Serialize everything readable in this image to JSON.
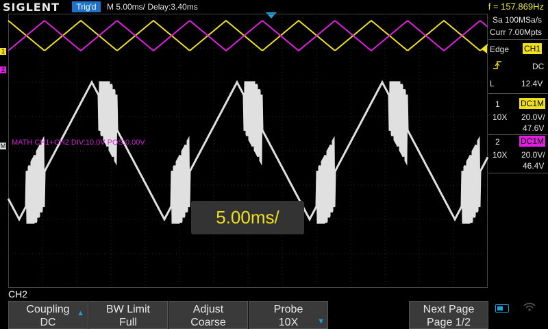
{
  "header": {
    "brand": "SIGLENT",
    "trigger_status": "Trig'd",
    "timebase": "M 5.00ms/ Delay:3.40ms",
    "frequency": "f = 157.869Hz"
  },
  "acquisition": {
    "sample_rate": "Sa 100MSa/s",
    "memory": "Curr 7.00Mpts"
  },
  "trigger": {
    "type": "Edge",
    "source": "CH1",
    "slope_icon": "rising-edge-icon",
    "coupling": "DC",
    "mode": "L",
    "level": "12.4V"
  },
  "channels": [
    {
      "num": "1",
      "coupling": "DC1M",
      "probe": "10X",
      "scale": "20.0V/",
      "offset": "47.6V",
      "color": "#f0e020"
    },
    {
      "num": "2",
      "coupling": "DC1M",
      "probe": "10X",
      "scale": "20.0V/",
      "offset": "46.4V",
      "color": "#e020e0"
    }
  ],
  "math": {
    "label": "MATH  CH1+CH2  DIV:10.0V  POS:0.00V"
  },
  "overlay": {
    "timebase_popup": "5.00ms/"
  },
  "menu": {
    "title": "CH2",
    "keys": [
      {
        "line1": "Coupling",
        "line2": "DC",
        "arrow": true
      },
      {
        "line1": "BW Limit",
        "line2": "Full",
        "arrow": false
      },
      {
        "line1": "Adjust",
        "line2": "Coarse",
        "arrow": false
      },
      {
        "line1": "Probe",
        "line2": "10X",
        "arrow": true
      },
      {
        "line1": "Next Page",
        "line2": "Page 1/2",
        "arrow": false
      }
    ]
  },
  "markers": {
    "ch1": "1",
    "ch2": "2",
    "math": "M"
  },
  "colors": {
    "ch1": "#f0e020",
    "ch2": "#e020e0",
    "math": "#e0e0e0",
    "accent": "#1ea0dc"
  }
}
